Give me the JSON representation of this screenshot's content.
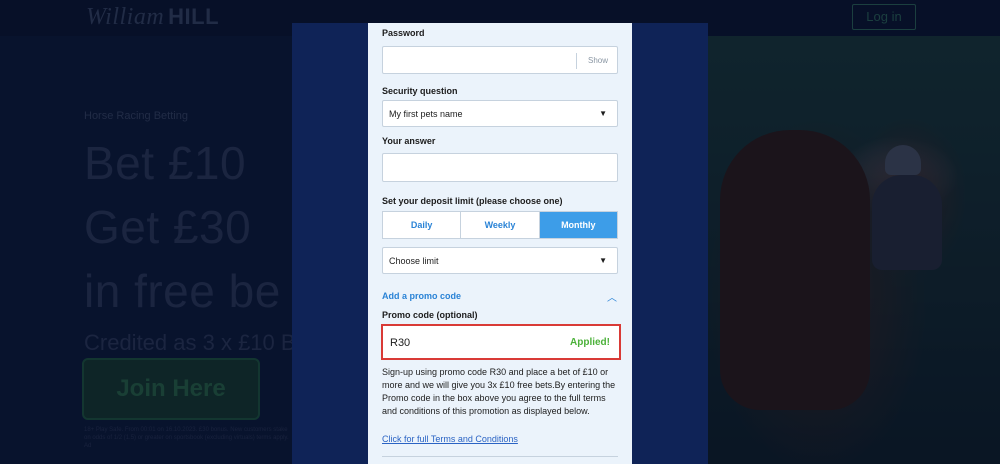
{
  "background": {
    "logo_script": "William",
    "logo_bold": "HILL",
    "login_label": "Log in",
    "hero_kicker": "Horse Racing Betting",
    "hero_line1": "Bet £10",
    "hero_line2": "Get £30",
    "hero_line3": "in free be",
    "hero_credited": "Credited as 3 x £10 B",
    "join_label": "Join Here",
    "legal_text": "18+ Play Safe. From 00:01 on 16.10.2023. £30 bonus. New customers stake on odds of 1/2 (1.5) or greater on sportsbook (excluding virtuals) terms apply. Ad"
  },
  "form": {
    "password": {
      "label": "Password",
      "value": "",
      "show_label": "Show"
    },
    "security_question": {
      "label": "Security question",
      "selected": "My first pets name"
    },
    "answer": {
      "label": "Your answer",
      "value": ""
    },
    "deposit_limit": {
      "label": "Set your deposit limit (please choose one)",
      "tabs": [
        {
          "label": "Daily",
          "active": false
        },
        {
          "label": "Weekly",
          "active": false
        },
        {
          "label": "Monthly",
          "active": true
        }
      ],
      "select_value": "Choose limit"
    },
    "promo": {
      "toggle_label": "Add a promo code",
      "label": "Promo code (optional)",
      "value": "R30",
      "status": "Applied!",
      "terms": "Sign-up using promo code R30 and place a bet of £10 or more and we will give you 3x £10 free bets.By entering the Promo code in the box above you agree to the full terms and conditions of this promotion as displayed below.",
      "terms_link": "Click for full Terms and Conditions"
    }
  },
  "icons": {
    "caret": "▼",
    "chevron_up": "︿"
  },
  "colors": {
    "accent_blue": "#3d9de8",
    "link_blue": "#2a83d6",
    "applied_green": "#4cb13a",
    "highlight_red": "#d93a36",
    "panel_bg": "#ebf3fb",
    "modal_navy": "#0f2357"
  }
}
